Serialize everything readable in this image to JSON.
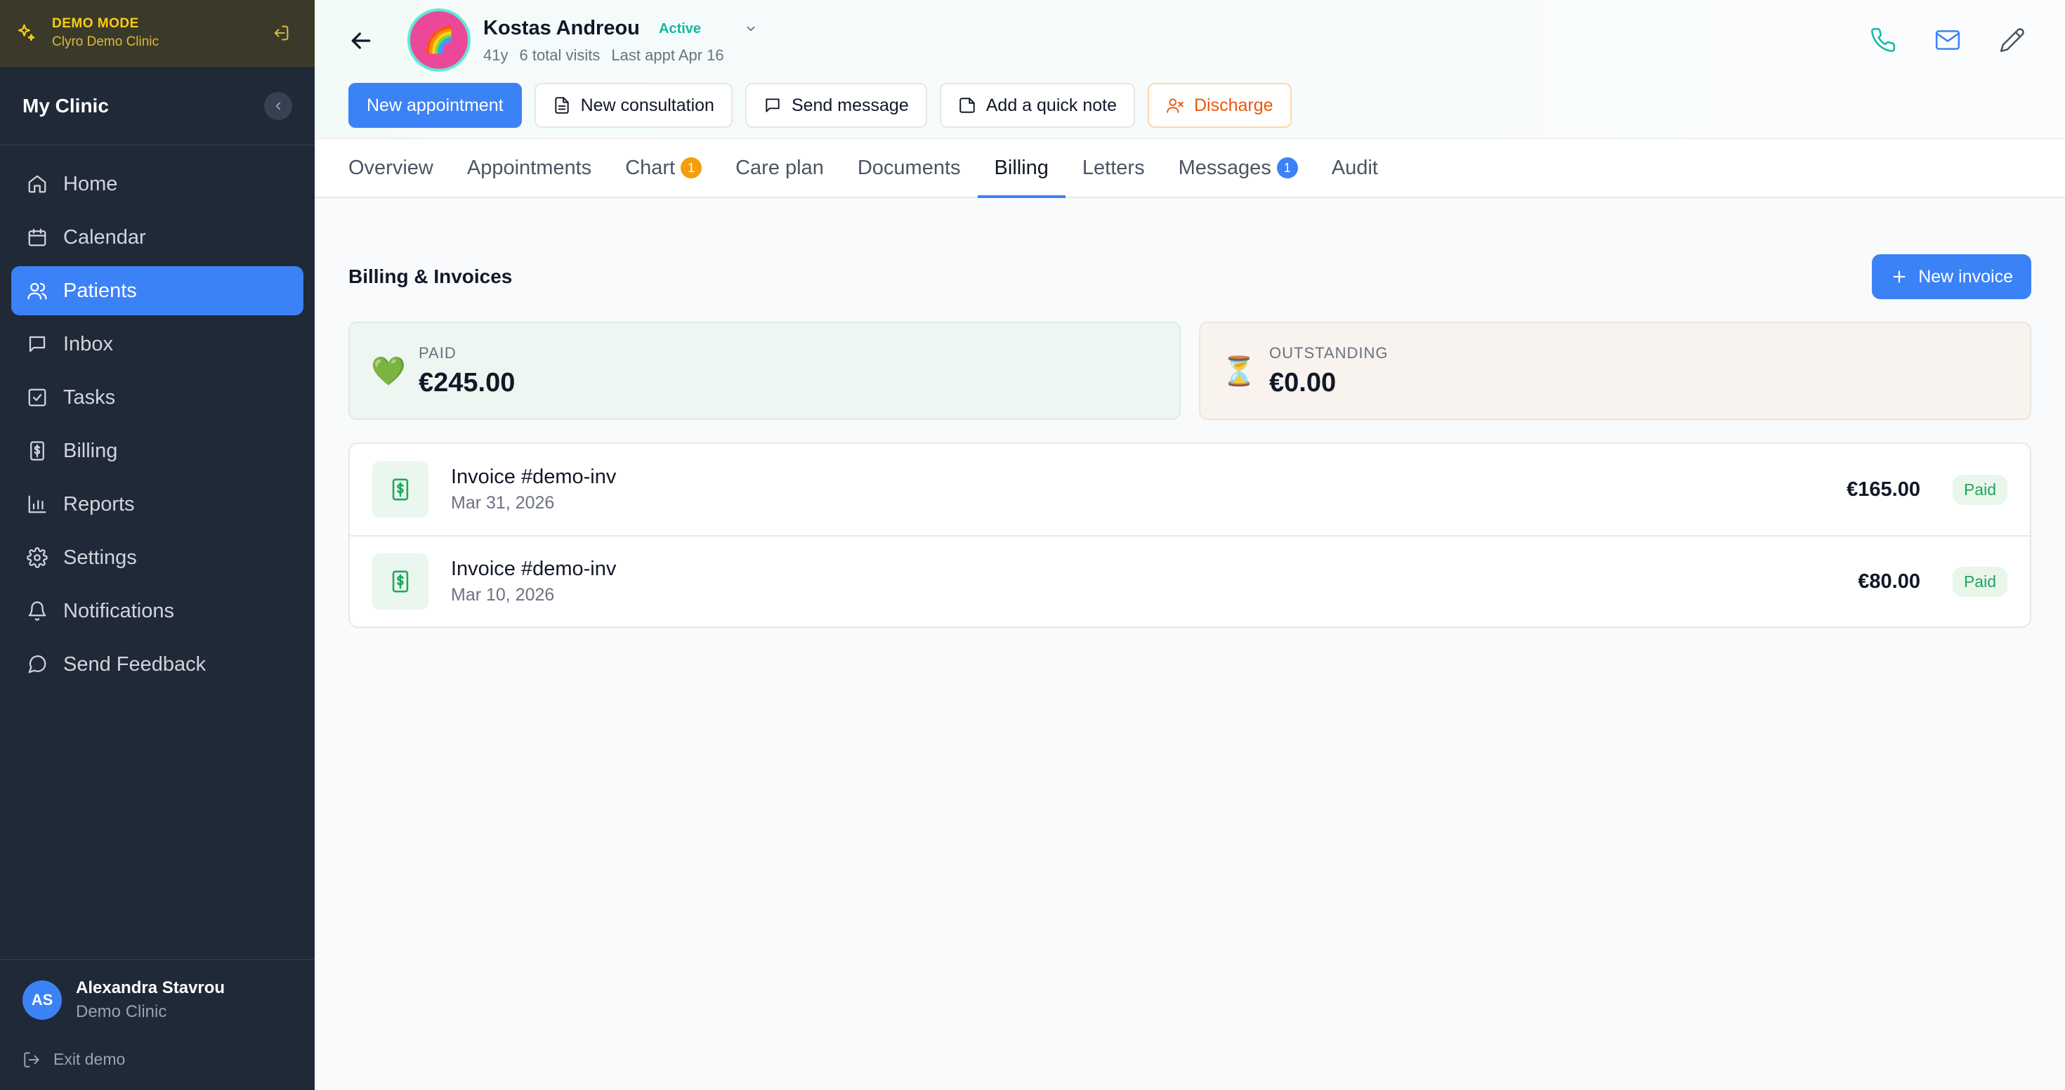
{
  "demo": {
    "mode_label": "DEMO MODE",
    "clinic": "Clyro Demo Clinic"
  },
  "sidebar": {
    "clinic_name": "My Clinic",
    "items": [
      {
        "label": "Home",
        "icon": "home-icon"
      },
      {
        "label": "Calendar",
        "icon": "calendar-icon"
      },
      {
        "label": "Patients",
        "icon": "users-icon",
        "active": true
      },
      {
        "label": "Inbox",
        "icon": "inbox-icon"
      },
      {
        "label": "Tasks",
        "icon": "check-square-icon"
      },
      {
        "label": "Billing",
        "icon": "billing-icon"
      },
      {
        "label": "Reports",
        "icon": "bar-chart-icon"
      },
      {
        "label": "Settings",
        "icon": "gear-icon"
      },
      {
        "label": "Notifications",
        "icon": "bell-icon"
      },
      {
        "label": "Send Feedback",
        "icon": "message-circle-icon"
      }
    ],
    "user": {
      "initials": "AS",
      "name": "Alexandra Stavrou",
      "clinic": "Demo Clinic"
    },
    "exit_label": "Exit demo"
  },
  "patient": {
    "name": "Kostas Andreou",
    "status": "Active",
    "age": "41y",
    "visits": "6 total visits",
    "last_appt": "Last appt Apr 16",
    "avatar_emoji": "🌈"
  },
  "actions": {
    "new_appointment": "New appointment",
    "new_consultation": "New consultation",
    "send_message": "Send message",
    "quick_note": "Add a quick note",
    "discharge": "Discharge"
  },
  "tabs": [
    {
      "label": "Overview"
    },
    {
      "label": "Appointments"
    },
    {
      "label": "Chart",
      "badge": "1"
    },
    {
      "label": "Care plan"
    },
    {
      "label": "Documents"
    },
    {
      "label": "Billing",
      "active": true
    },
    {
      "label": "Letters"
    },
    {
      "label": "Messages",
      "badge": "1"
    },
    {
      "label": "Audit"
    }
  ],
  "billing": {
    "title": "Billing & Invoices",
    "new_invoice": "New invoice",
    "paid": {
      "label": "PAID",
      "amount": "€245.00",
      "icon": "💚"
    },
    "outstanding": {
      "label": "OUTSTANDING",
      "amount": "€0.00",
      "icon": "⏳"
    },
    "invoices": [
      {
        "title": "Invoice #demo-inv",
        "date": "Mar 31, 2026",
        "amount": "€165.00",
        "status": "Paid"
      },
      {
        "title": "Invoice #demo-inv",
        "date": "Mar 10, 2026",
        "amount": "€80.00",
        "status": "Paid"
      }
    ]
  }
}
